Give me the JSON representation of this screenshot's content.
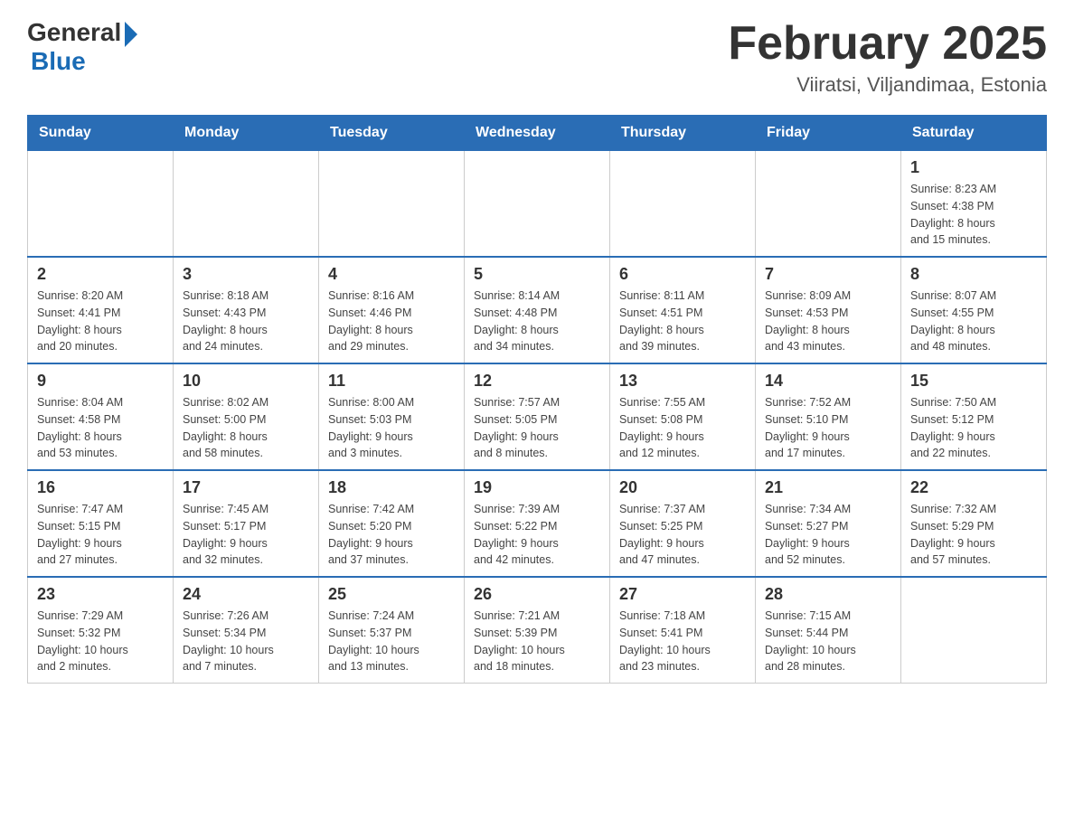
{
  "header": {
    "logo": {
      "general": "General",
      "blue": "Blue",
      "subtitle": "Blue"
    },
    "title": "February 2025",
    "location": "Viiratsi, Viljandimaa, Estonia"
  },
  "days_of_week": [
    "Sunday",
    "Monday",
    "Tuesday",
    "Wednesday",
    "Thursday",
    "Friday",
    "Saturday"
  ],
  "weeks": [
    [
      {
        "day": "",
        "info": ""
      },
      {
        "day": "",
        "info": ""
      },
      {
        "day": "",
        "info": ""
      },
      {
        "day": "",
        "info": ""
      },
      {
        "day": "",
        "info": ""
      },
      {
        "day": "",
        "info": ""
      },
      {
        "day": "1",
        "info": "Sunrise: 8:23 AM\nSunset: 4:38 PM\nDaylight: 8 hours\nand 15 minutes."
      }
    ],
    [
      {
        "day": "2",
        "info": "Sunrise: 8:20 AM\nSunset: 4:41 PM\nDaylight: 8 hours\nand 20 minutes."
      },
      {
        "day": "3",
        "info": "Sunrise: 8:18 AM\nSunset: 4:43 PM\nDaylight: 8 hours\nand 24 minutes."
      },
      {
        "day": "4",
        "info": "Sunrise: 8:16 AM\nSunset: 4:46 PM\nDaylight: 8 hours\nand 29 minutes."
      },
      {
        "day": "5",
        "info": "Sunrise: 8:14 AM\nSunset: 4:48 PM\nDaylight: 8 hours\nand 34 minutes."
      },
      {
        "day": "6",
        "info": "Sunrise: 8:11 AM\nSunset: 4:51 PM\nDaylight: 8 hours\nand 39 minutes."
      },
      {
        "day": "7",
        "info": "Sunrise: 8:09 AM\nSunset: 4:53 PM\nDaylight: 8 hours\nand 43 minutes."
      },
      {
        "day": "8",
        "info": "Sunrise: 8:07 AM\nSunset: 4:55 PM\nDaylight: 8 hours\nand 48 minutes."
      }
    ],
    [
      {
        "day": "9",
        "info": "Sunrise: 8:04 AM\nSunset: 4:58 PM\nDaylight: 8 hours\nand 53 minutes."
      },
      {
        "day": "10",
        "info": "Sunrise: 8:02 AM\nSunset: 5:00 PM\nDaylight: 8 hours\nand 58 minutes."
      },
      {
        "day": "11",
        "info": "Sunrise: 8:00 AM\nSunset: 5:03 PM\nDaylight: 9 hours\nand 3 minutes."
      },
      {
        "day": "12",
        "info": "Sunrise: 7:57 AM\nSunset: 5:05 PM\nDaylight: 9 hours\nand 8 minutes."
      },
      {
        "day": "13",
        "info": "Sunrise: 7:55 AM\nSunset: 5:08 PM\nDaylight: 9 hours\nand 12 minutes."
      },
      {
        "day": "14",
        "info": "Sunrise: 7:52 AM\nSunset: 5:10 PM\nDaylight: 9 hours\nand 17 minutes."
      },
      {
        "day": "15",
        "info": "Sunrise: 7:50 AM\nSunset: 5:12 PM\nDaylight: 9 hours\nand 22 minutes."
      }
    ],
    [
      {
        "day": "16",
        "info": "Sunrise: 7:47 AM\nSunset: 5:15 PM\nDaylight: 9 hours\nand 27 minutes."
      },
      {
        "day": "17",
        "info": "Sunrise: 7:45 AM\nSunset: 5:17 PM\nDaylight: 9 hours\nand 32 minutes."
      },
      {
        "day": "18",
        "info": "Sunrise: 7:42 AM\nSunset: 5:20 PM\nDaylight: 9 hours\nand 37 minutes."
      },
      {
        "day": "19",
        "info": "Sunrise: 7:39 AM\nSunset: 5:22 PM\nDaylight: 9 hours\nand 42 minutes."
      },
      {
        "day": "20",
        "info": "Sunrise: 7:37 AM\nSunset: 5:25 PM\nDaylight: 9 hours\nand 47 minutes."
      },
      {
        "day": "21",
        "info": "Sunrise: 7:34 AM\nSunset: 5:27 PM\nDaylight: 9 hours\nand 52 minutes."
      },
      {
        "day": "22",
        "info": "Sunrise: 7:32 AM\nSunset: 5:29 PM\nDaylight: 9 hours\nand 57 minutes."
      }
    ],
    [
      {
        "day": "23",
        "info": "Sunrise: 7:29 AM\nSunset: 5:32 PM\nDaylight: 10 hours\nand 2 minutes."
      },
      {
        "day": "24",
        "info": "Sunrise: 7:26 AM\nSunset: 5:34 PM\nDaylight: 10 hours\nand 7 minutes."
      },
      {
        "day": "25",
        "info": "Sunrise: 7:24 AM\nSunset: 5:37 PM\nDaylight: 10 hours\nand 13 minutes."
      },
      {
        "day": "26",
        "info": "Sunrise: 7:21 AM\nSunset: 5:39 PM\nDaylight: 10 hours\nand 18 minutes."
      },
      {
        "day": "27",
        "info": "Sunrise: 7:18 AM\nSunset: 5:41 PM\nDaylight: 10 hours\nand 23 minutes."
      },
      {
        "day": "28",
        "info": "Sunrise: 7:15 AM\nSunset: 5:44 PM\nDaylight: 10 hours\nand 28 minutes."
      },
      {
        "day": "",
        "info": ""
      }
    ]
  ]
}
